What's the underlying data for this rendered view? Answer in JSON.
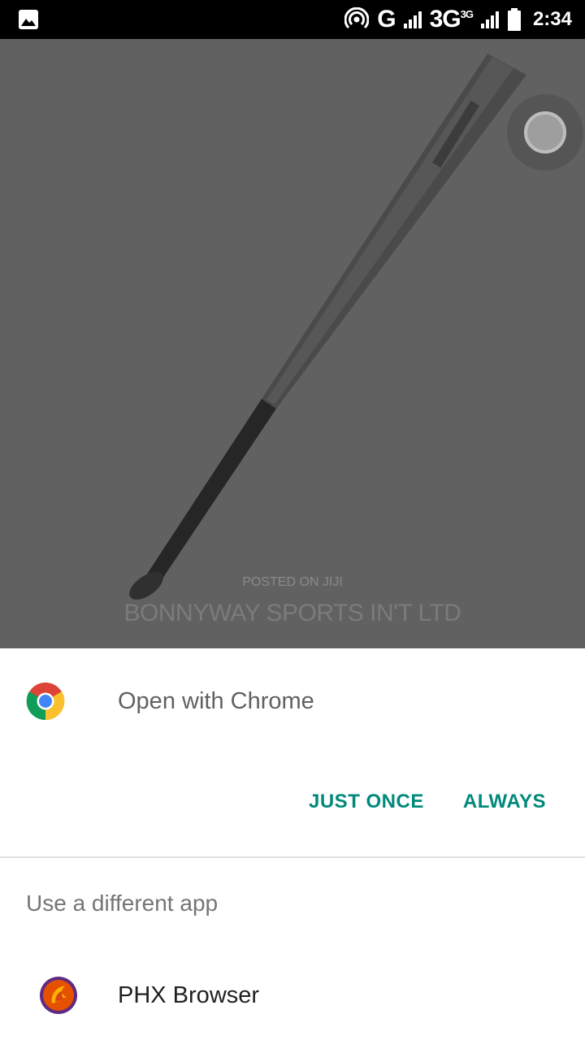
{
  "status_bar": {
    "left_icon": "image-icon",
    "hotspot_icon": "hotspot-icon",
    "network_1": "G",
    "network_2": "3G",
    "network_2_sup": "3G",
    "battery_icon": "battery-icon",
    "time": "2:34"
  },
  "background_image": {
    "subject": "baseball-bat-image",
    "watermark_small": "POSTED ON JIJI",
    "watermark_big": "BONNYWAY SPORTS IN'T LTD"
  },
  "chooser": {
    "primary_app_icon": "chrome-icon",
    "primary_label": "Open with Chrome",
    "just_once": "JUST ONCE",
    "always": "ALWAYS",
    "section_title": "Use a different app",
    "apps": [
      {
        "icon": "phx-browser-icon",
        "label": "PHX Browser"
      }
    ]
  },
  "colors": {
    "accent": "#00897b",
    "backdrop": "#616161",
    "status_bar": "#000000"
  }
}
